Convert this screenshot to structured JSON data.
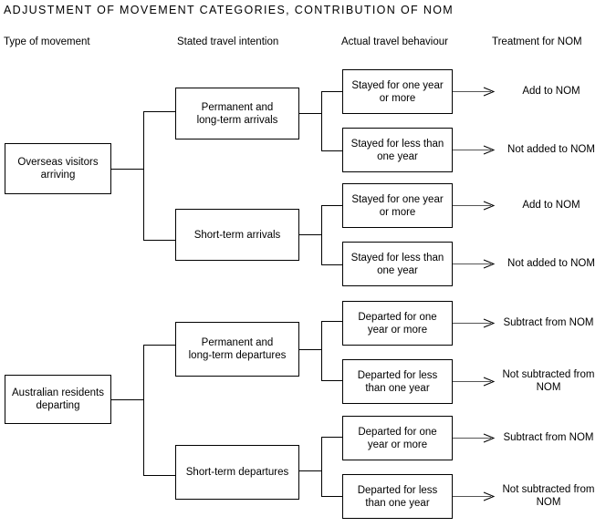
{
  "title": "ADJUSTMENT OF MOVEMENT CATEGORIES, CONTRIBUTION OF NOM",
  "column_headers": [
    {
      "label": "Type of movement"
    },
    {
      "label": "Stated travel intention"
    },
    {
      "label": "Actual travel behaviour"
    },
    {
      "label": "Treatment for NOM"
    }
  ],
  "nodes": {
    "overseas_visitors": "Overseas visitors\narriving",
    "australian_residents": "Australian residents\ndeparting",
    "permanent_long_term_arrivals": "Permanent and\nlong-term arrivals",
    "short_term_arrivals": "Short-term arrivals",
    "permanent_long_term_departures": "Permanent and\nlong-term departures",
    "short_term_departures": "Short-term departures",
    "stayed_one_year_a": "Stayed for one year\nor more",
    "stayed_less_year_a": "Stayed for less than\none year",
    "stayed_one_year_b": "Stayed for one year\nor more",
    "stayed_less_year_b": "Stayed for less than\none year",
    "departed_one_year_a": "Departed for one\nyear or more",
    "departed_less_year_a": "Departed for less\nthan one year",
    "departed_one_year_b": "Departed for one\nyear or more",
    "departed_less_year_b": "Departed for less\nthan one year"
  },
  "outcomes": {
    "add_nom_a": "Add to NOM",
    "not_added_nom_a": "Not added to NOM",
    "add_nom_b": "Add to NOM",
    "not_added_nom_b": "Not added to NOM",
    "subtract_nom_a": "Subtract from NOM",
    "not_subtracted_nom_a": "Not subtracted from\nNOM",
    "subtract_nom_b": "Subtract from NOM",
    "not_subtracted_nom_b": "Not subtracted from\nNOM"
  },
  "colors": {
    "line": "#000000",
    "text": "#000000",
    "background": "#ffffff"
  }
}
